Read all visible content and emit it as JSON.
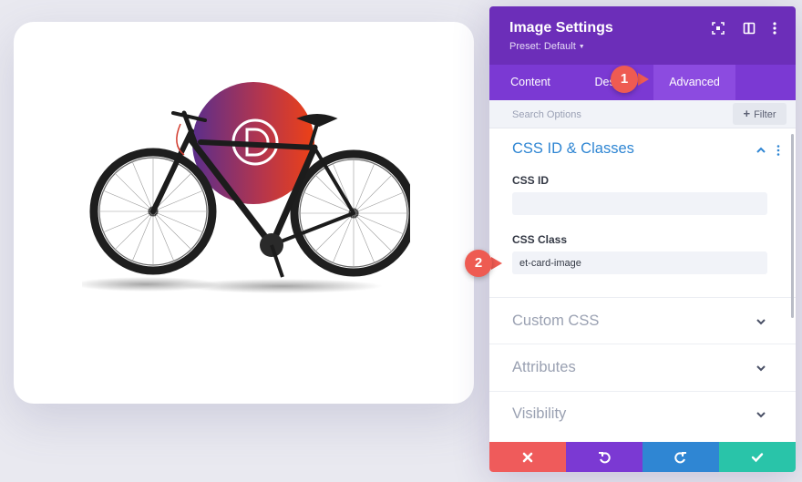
{
  "panel": {
    "title": "Image Settings",
    "preset": "Preset: Default"
  },
  "tabs": [
    "Content",
    "Design",
    "Advanced"
  ],
  "active_tab": "Advanced",
  "search": {
    "placeholder": "Search Options",
    "filter_label": "Filter"
  },
  "sections": {
    "css": {
      "title": "CSS ID & Classes",
      "css_id_label": "CSS ID",
      "css_id_value": "",
      "css_class_label": "CSS Class",
      "css_class_value": "et-card-image"
    },
    "custom_css": {
      "title": "Custom CSS"
    },
    "attributes": {
      "title": "Attributes"
    },
    "visibility": {
      "title": "Visibility"
    }
  },
  "callouts": [
    "1",
    "2"
  ],
  "colors": {
    "header": "#6c2eb9",
    "tabs": "#7b39d3",
    "active_tab": "#8c4be0",
    "section_open": "#2f86d3",
    "callout": "#ee5b52",
    "cancel": "#ef5b5b",
    "undo": "#7b39d3",
    "redo": "#2f86d3",
    "save": "#29c4a9"
  },
  "icons": {
    "header": [
      "expand-icon",
      "split-view-icon",
      "more-options-icon"
    ],
    "footer": [
      "close-icon",
      "undo-icon",
      "redo-icon",
      "check-icon"
    ]
  }
}
